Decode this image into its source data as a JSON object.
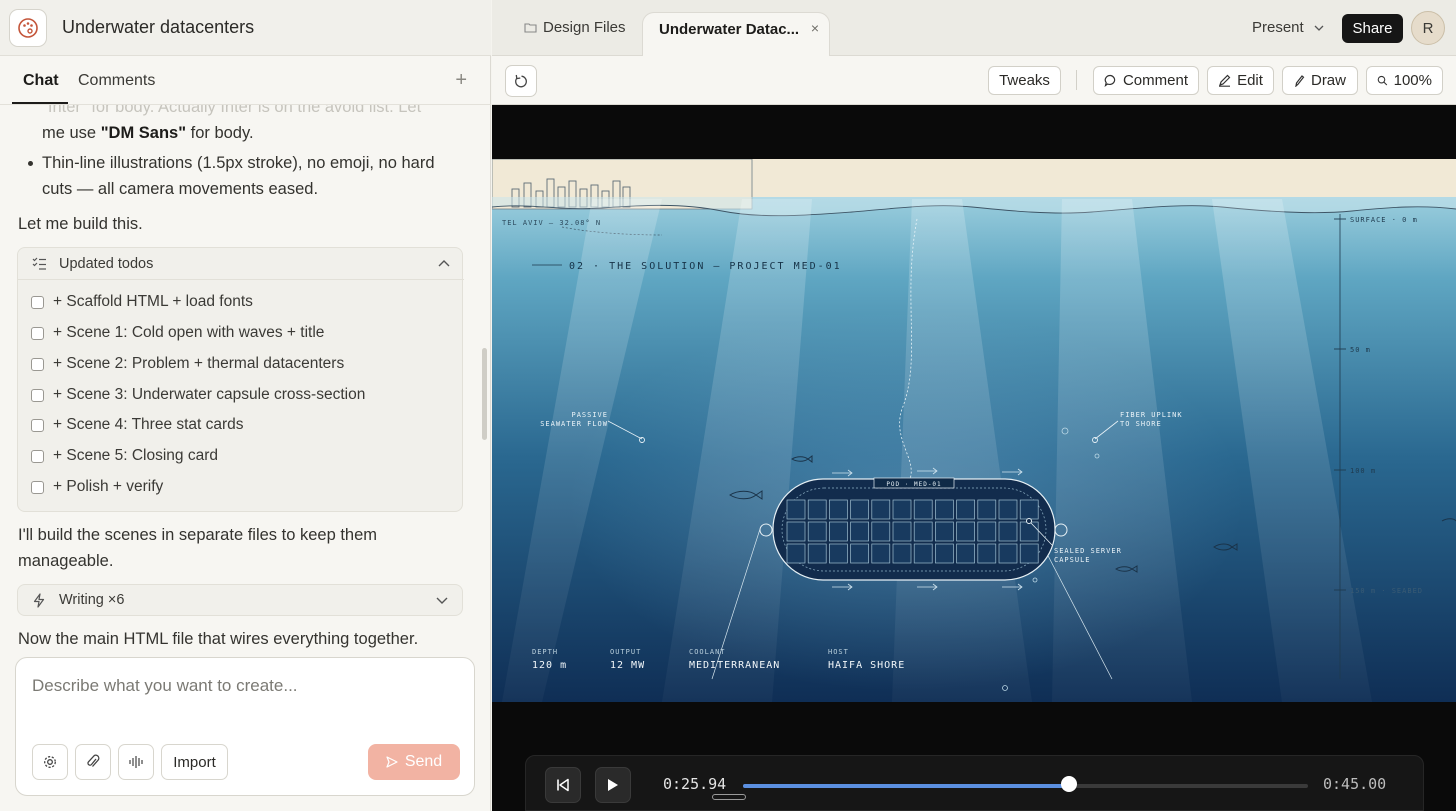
{
  "app": {
    "project_title": "Underwater datacenters"
  },
  "chat_tabs": {
    "chat": "Chat",
    "comments": "Comments",
    "add": "+"
  },
  "chat": {
    "faded_line": "\"Inter\" for body. Actually Inter is on the avoid list. Let",
    "line2_pre": "me use ",
    "line2_bold": "\"DM Sans\"",
    "line2_post": " for body.",
    "bullet_line1": "Thin-line illustrations (1.5px stroke), no emoji, no hard",
    "bullet_line2": "cuts — all camera movements eased.",
    "let_me_build": "Let me build this.",
    "todos_title": "Updated todos",
    "todos": [
      "+ Scaffold HTML + load fonts",
      "+ Scene 1: Cold open with waves + title",
      "+ Scene 2: Problem + thermal datacenters",
      "+ Scene 3: Underwater capsule cross-section",
      "+ Scene 4: Three stat cards",
      "+ Scene 5: Closing card",
      "+ Polish + verify"
    ],
    "separate_line1": "I'll build the scenes in separate files to keep them",
    "separate_line2": "manageable.",
    "writing_title": "Writing ×6",
    "main_html": "Now the main HTML file that wires everything together."
  },
  "composer": {
    "placeholder": "Describe what you want to create...",
    "import_label": "Import",
    "send_label": "Send"
  },
  "tabs": {
    "design_files": "Design Files",
    "active": "Underwater Datac...",
    "close": "×",
    "present": "Present",
    "share": "Share",
    "avatar_initial": "R"
  },
  "toolbar": {
    "tweaks": "Tweaks",
    "comment": "Comment",
    "edit": "Edit",
    "draw": "Draw",
    "zoom": "100%"
  },
  "scene": {
    "location": "TEL AVIV — 32.08° N",
    "heading": "02 · THE SOLUTION — PROJECT MED-01",
    "depth_labels": [
      "SURFACE · 0 m",
      "50 m",
      "100 m",
      "150 m · SEABED"
    ],
    "passive_line1": "PASSIVE",
    "passive_line2": "SEAWATER FLOW",
    "fiber_line1": "FIBER UPLINK",
    "fiber_line2": "TO SHORE",
    "pod_label": "POD · MED-01",
    "sealed_line1": "SEALED SERVER",
    "sealed_line2": "CAPSULE",
    "stats": [
      {
        "label": "DEPTH",
        "value": "120 m"
      },
      {
        "label": "OUTPUT",
        "value": "12 MW"
      },
      {
        "label": "COOLANT",
        "value": "MEDITERRANEAN"
      },
      {
        "label": "HOST",
        "value": "HAIFA SHORE"
      }
    ]
  },
  "player": {
    "current": "0:25.94",
    "total": "0:45.00",
    "progress": 0.5767
  },
  "colors": {
    "accent_blue": "#5b8fe0",
    "send_disabled": "#f2b3a3",
    "ocean_top": "#a7d8e6",
    "ocean_bottom": "#0e2c52"
  }
}
